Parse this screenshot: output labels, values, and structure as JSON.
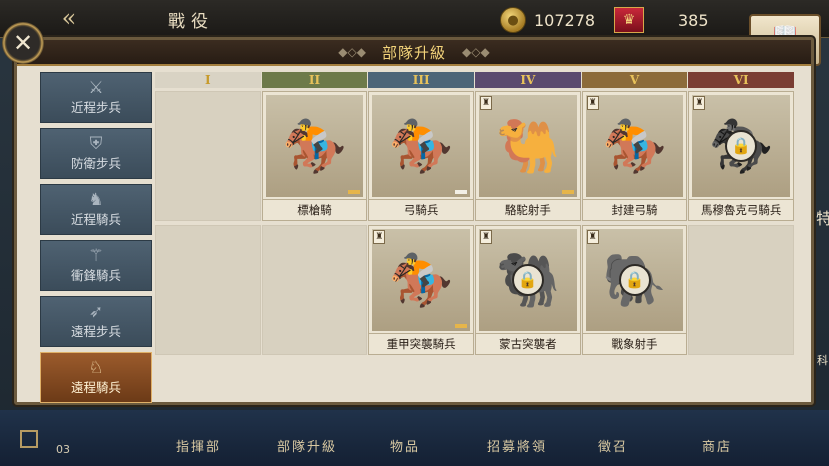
{
  "header": {
    "back_arrow": "«",
    "page_title": "戰役",
    "gold": "107278",
    "honor": "385",
    "codex_label": "圖鑒"
  },
  "panel": {
    "title": "部隊升級",
    "close_icon": "✕"
  },
  "sidebar": [
    {
      "label": "近程步兵",
      "icon": "⚔"
    },
    {
      "label": "防衛步兵",
      "icon": "⛨"
    },
    {
      "label": "近程騎兵",
      "icon": "♞"
    },
    {
      "label": "衝鋒騎兵",
      "icon": "⚚"
    },
    {
      "label": "遠程步兵",
      "icon": "➶"
    },
    {
      "label": "遠程騎兵",
      "icon": "♘",
      "active": true
    }
  ],
  "tiers": [
    "I",
    "II",
    "III",
    "IV",
    "V",
    "VI"
  ],
  "units_row1": [
    {
      "name": "",
      "empty": true
    },
    {
      "name": "標槍騎",
      "locked": false,
      "level_color": "gold"
    },
    {
      "name": "弓騎兵",
      "locked": false,
      "level_color": "white"
    },
    {
      "name": "駱駝射手",
      "locked": false,
      "level_color": "gold",
      "tower": true
    },
    {
      "name": "封建弓騎",
      "locked": false,
      "tower": true
    },
    {
      "name": "馬穆魯克弓騎兵",
      "locked": true,
      "tower": true
    }
  ],
  "units_row2": [
    {
      "name": "",
      "empty": true
    },
    {
      "name": "",
      "empty": true
    },
    {
      "name": "重甲突襲騎兵",
      "locked": false,
      "level_color": "gold",
      "tower": true
    },
    {
      "name": "蒙古突襲者",
      "locked": true,
      "tower": true
    },
    {
      "name": "戰象射手",
      "locked": true,
      "tower": true
    },
    {
      "name": "",
      "empty": true
    }
  ],
  "bottom_nav": [
    "指揮部",
    "部隊升級",
    "物品",
    "招募將領",
    "徵召",
    "商店"
  ],
  "page_num": "03",
  "edge_labels": [
    "特",
    "科"
  ]
}
